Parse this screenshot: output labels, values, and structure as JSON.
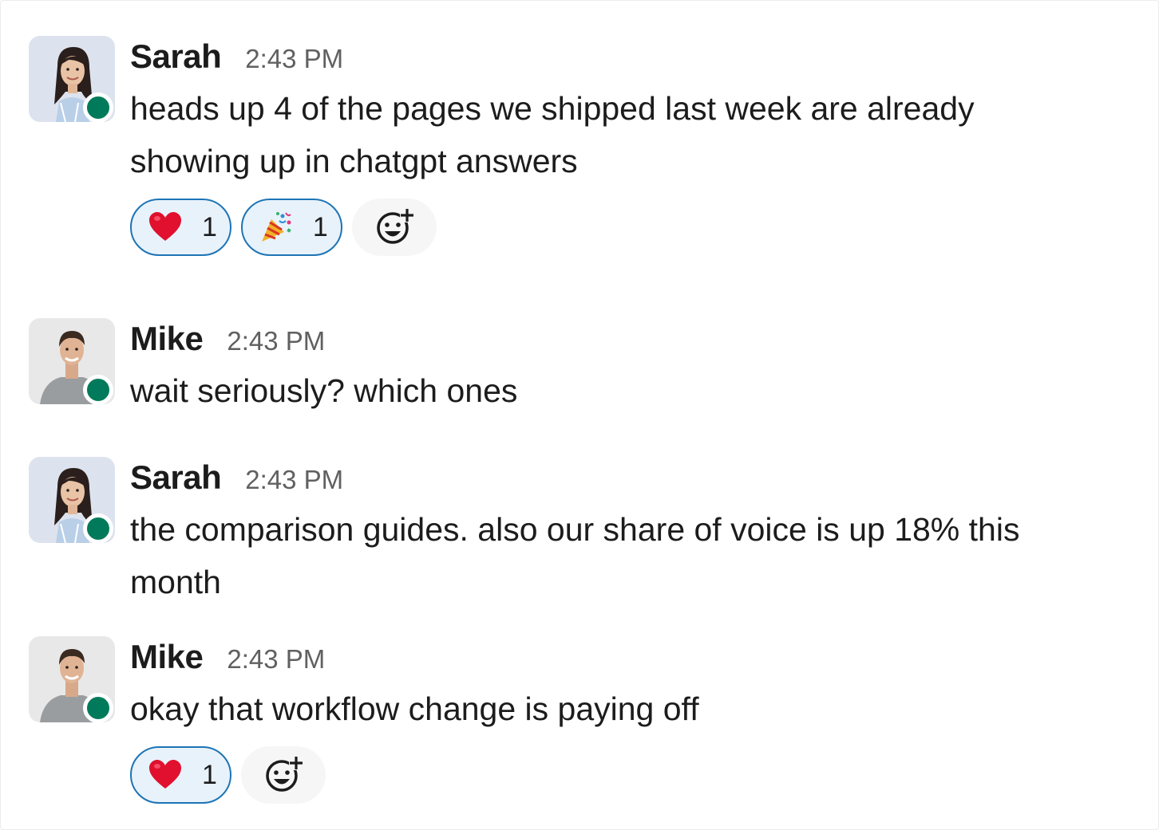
{
  "messages": [
    {
      "author": "Sarah",
      "time": "2:43 PM",
      "text": "heads up 4 of the pages we shipped last week are already showing up in chatgpt answers",
      "avatar": "sarah-avatar",
      "reactions": [
        {
          "emoji": "heart",
          "count": "1"
        },
        {
          "emoji": "party-popper",
          "count": "1"
        }
      ]
    },
    {
      "author": "Mike",
      "time": "2:43 PM",
      "text": "wait seriously? which ones",
      "avatar": "mike-avatar",
      "reactions": []
    },
    {
      "author": "Sarah",
      "time": "2:43 PM",
      "text": "the comparison guides. also our share of voice is up 18% this month",
      "avatar": "sarah-avatar",
      "reactions": []
    },
    {
      "author": "Mike",
      "time": "2:43 PM",
      "text": "okay that workflow change is paying off",
      "avatar": "mike-avatar",
      "reactions": [
        {
          "emoji": "heart",
          "count": "1"
        }
      ]
    }
  ],
  "colors": {
    "presence": "#007a5a",
    "reaction_border": "#1d74b5",
    "reaction_bg": "#e8f2fb",
    "heart": "#e0102e"
  }
}
